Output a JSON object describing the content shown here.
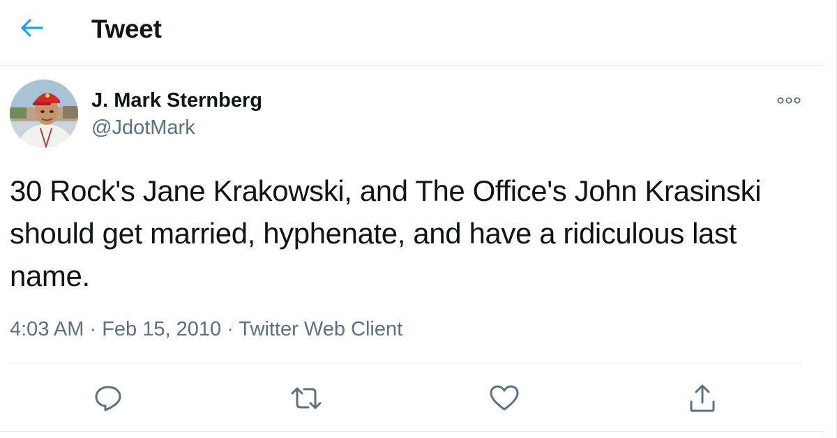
{
  "colors": {
    "accent": "#1da1f2",
    "text_primary": "#0f1419",
    "text_secondary": "#5b7083",
    "border": "#e6ecf0"
  },
  "header": {
    "back_icon": "arrow-left-icon",
    "title": "Tweet"
  },
  "tweet": {
    "author": {
      "name": "J. Mark Sternberg",
      "handle": "@JdotMark"
    },
    "more_icon": "more-options-icon",
    "text": "30 Rock's Jane Krakowski, and The Office's John Krasinski should get married, hyphenate, and have a ridiculous last name.",
    "time": "4:03 AM",
    "separator": "·",
    "date": "Feb 15, 2010",
    "source": "Twitter Web Client"
  },
  "actions": [
    {
      "icon": "reply-icon"
    },
    {
      "icon": "retweet-icon"
    },
    {
      "icon": "like-icon"
    },
    {
      "icon": "share-icon"
    }
  ]
}
